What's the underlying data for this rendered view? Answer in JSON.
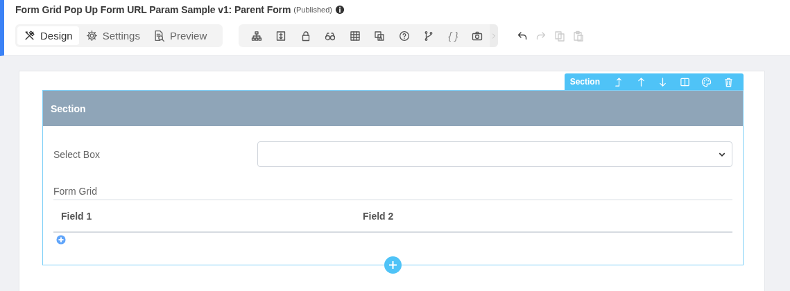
{
  "header": {
    "title": "Form Grid Pop Up Form URL Param Sample v1: Parent Form",
    "status": "(Published)"
  },
  "tabs": [
    {
      "label": "Design",
      "kind": "design",
      "selected": true
    },
    {
      "label": "Settings",
      "kind": "settings",
      "selected": false
    },
    {
      "label": "Preview",
      "kind": "preview",
      "selected": false
    }
  ],
  "tools": [
    {
      "kind": "hierarchy"
    },
    {
      "kind": "panel"
    },
    {
      "kind": "lock"
    },
    {
      "kind": "binoculars"
    },
    {
      "kind": "grid"
    },
    {
      "kind": "translate"
    },
    {
      "kind": "help"
    },
    {
      "kind": "branch"
    },
    {
      "kind": "glyph",
      "text": "{ }"
    },
    {
      "kind": "camera"
    }
  ],
  "history": [
    {
      "kind": "undo",
      "disabled": false
    },
    {
      "kind": "redo",
      "disabled": true
    },
    {
      "kind": "copy",
      "disabled": true
    },
    {
      "kind": "paste",
      "disabled": true
    }
  ],
  "section_toolbar": {
    "label": "Section",
    "actions": [
      {
        "kind": "move-top"
      },
      {
        "kind": "up"
      },
      {
        "kind": "down"
      },
      {
        "kind": "columns"
      },
      {
        "kind": "palette"
      },
      {
        "kind": "delete"
      }
    ]
  },
  "section": {
    "title": "Section",
    "fields": [
      {
        "label": "Select Box",
        "kind": "select"
      }
    ],
    "grid": {
      "label": "Form Grid",
      "columns": [
        "Field 1",
        "Field 2"
      ]
    }
  }
}
